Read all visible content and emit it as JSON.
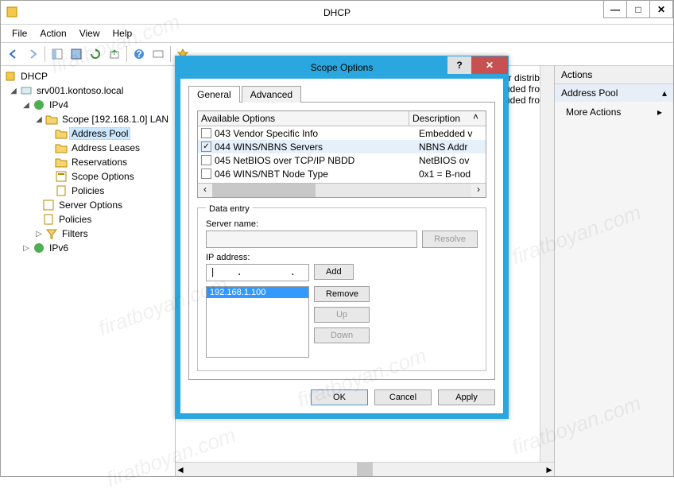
{
  "window": {
    "title": "DHCP",
    "min": "—",
    "max": "□",
    "close": "✕"
  },
  "menubar": [
    "File",
    "Action",
    "View",
    "Help"
  ],
  "tree": {
    "root": "DHCP",
    "server": "srv001.kontoso.local",
    "ipv4": "IPv4",
    "scope": "Scope [192.168.1.0] LAN",
    "pool": "Address Pool",
    "leases": "Address Leases",
    "reservations": "Reservations",
    "scopeopts": "Scope Options",
    "policies": "Policies",
    "serveropts": "Server Options",
    "policies2": "Policies",
    "filters": "Filters",
    "ipv6": "IPv6"
  },
  "center": {
    "line1": "or distribut",
    "line2": "cluded from",
    "line3": "cluded from"
  },
  "actions": {
    "header": "Actions",
    "sub": "Address Pool",
    "more": "More Actions"
  },
  "dialog": {
    "title": "Scope Options",
    "help": "?",
    "close": "✕",
    "tabs": {
      "general": "General",
      "advanced": "Advanced"
    },
    "options_hdr": {
      "name": "Available Options",
      "desc": "Description"
    },
    "options": [
      {
        "checked": false,
        "name": "043 Vendor Specific Info",
        "desc": "Embedded v"
      },
      {
        "checked": true,
        "name": "044 WINS/NBNS Servers",
        "desc": "NBNS Addr"
      },
      {
        "checked": false,
        "name": "045 NetBIOS over TCP/IP NBDD",
        "desc": "NetBIOS ov"
      },
      {
        "checked": false,
        "name": "046 WINS/NBT Node Type",
        "desc": "0x1 = B-nod"
      }
    ],
    "data_entry": "Data entry",
    "server_label": "Server name:",
    "resolve": "Resolve",
    "ip_label": "IP address:",
    "ip_value": "|  .     .     .",
    "add": "Add",
    "remove": "Remove",
    "up": "Up",
    "down": "Down",
    "ip_list": [
      "192.168.1.100"
    ],
    "ok": "OK",
    "cancel": "Cancel",
    "apply": "Apply"
  },
  "watermark": "firatboyan.com"
}
